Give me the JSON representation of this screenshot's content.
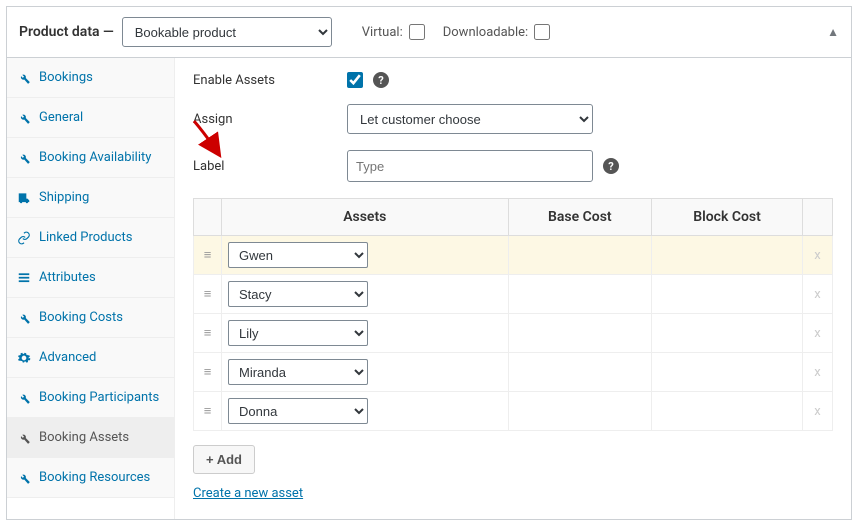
{
  "header": {
    "title": "Product data —",
    "product_type": "Bookable product",
    "virtual_label": "Virtual:",
    "downloadable_label": "Downloadable:"
  },
  "tabs": [
    {
      "label": "Bookings",
      "icon": "wrench"
    },
    {
      "label": "General",
      "icon": "wrench"
    },
    {
      "label": "Booking Availability",
      "icon": "wrench"
    },
    {
      "label": "Shipping",
      "icon": "truck"
    },
    {
      "label": "Linked Products",
      "icon": "link"
    },
    {
      "label": "Attributes",
      "icon": "list"
    },
    {
      "label": "Booking Costs",
      "icon": "wrench"
    },
    {
      "label": "Advanced",
      "icon": "gear"
    },
    {
      "label": "Booking Participants",
      "icon": "wrench"
    },
    {
      "label": "Booking Assets",
      "icon": "wrench",
      "active": true
    },
    {
      "label": "Booking Resources",
      "icon": "wrench"
    }
  ],
  "form": {
    "enable_assets_label": "Enable Assets",
    "enable_assets_checked": true,
    "assign_label": "Assign",
    "assign_value": "Let customer choose",
    "label_label": "Label",
    "label_placeholder": "Type"
  },
  "table": {
    "col_assets": "Assets",
    "col_base": "Base Cost",
    "col_block": "Block Cost",
    "rows": [
      {
        "asset": "Gwen",
        "highlight": true
      },
      {
        "asset": "Stacy"
      },
      {
        "asset": "Lily"
      },
      {
        "asset": "Miranda"
      },
      {
        "asset": "Donna"
      }
    ]
  },
  "add_button": "+ Add",
  "create_link": "Create a new asset"
}
